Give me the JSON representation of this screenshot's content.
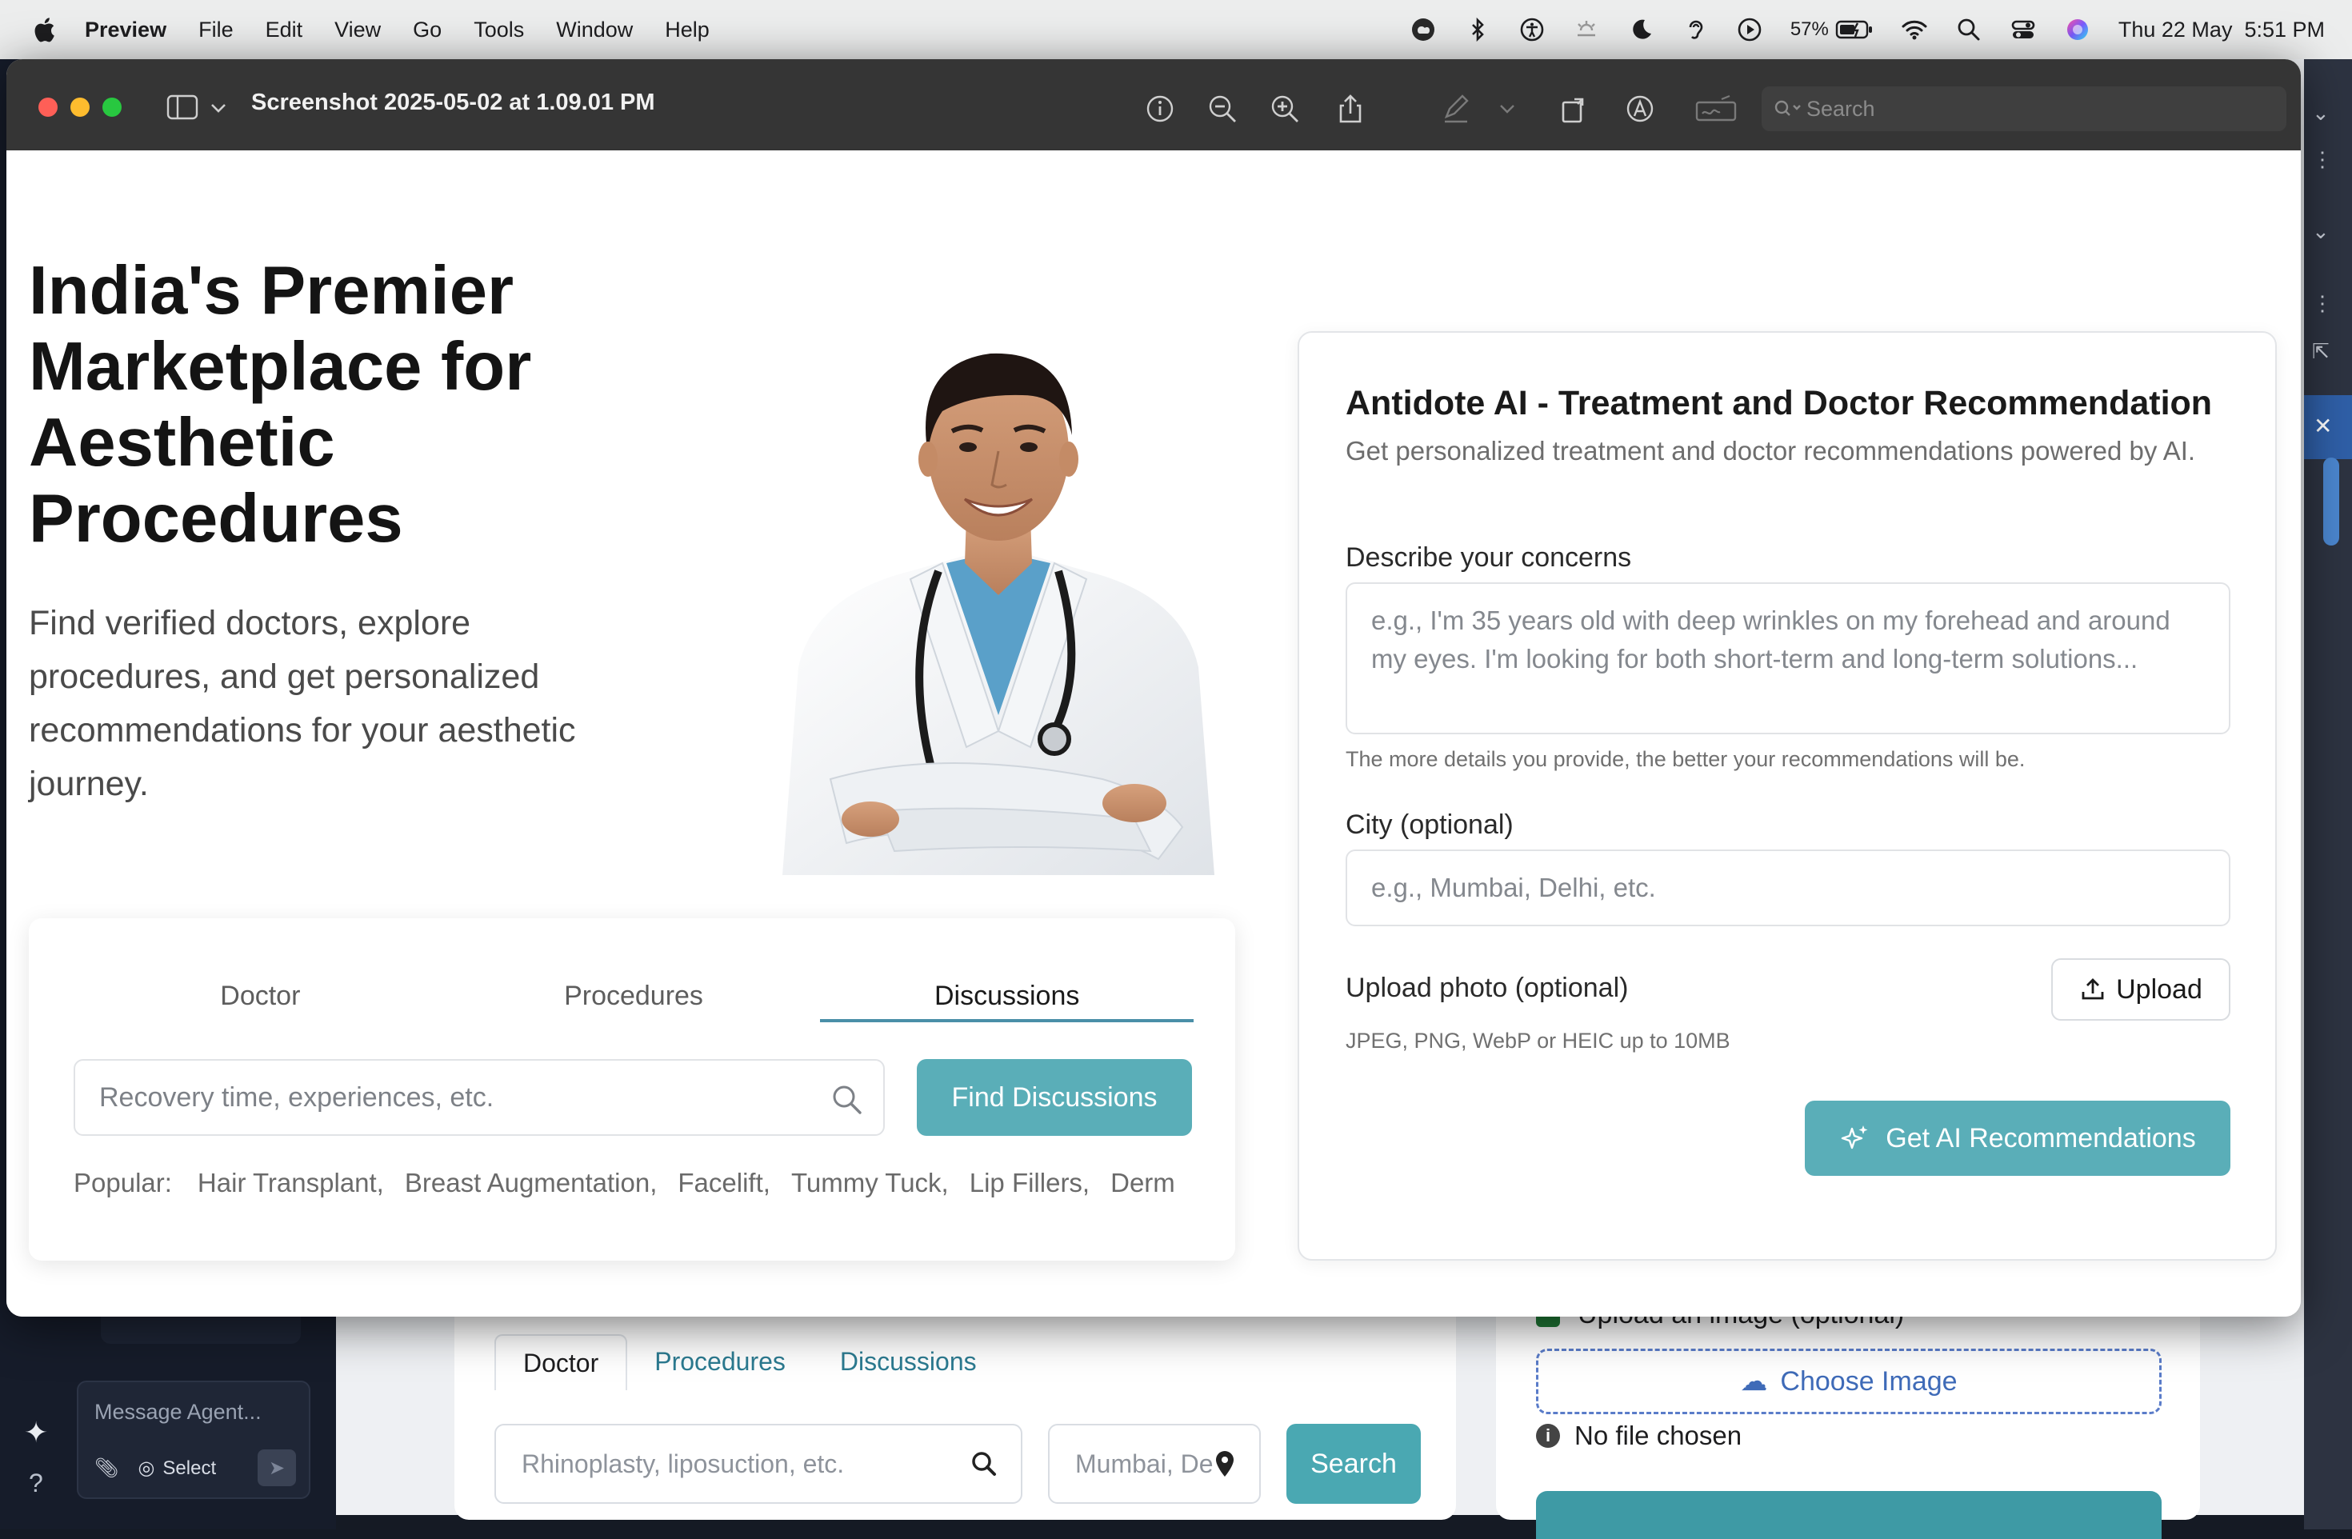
{
  "menubar": {
    "app_name": "Preview",
    "items": [
      "File",
      "Edit",
      "View",
      "Go",
      "Tools",
      "Window",
      "Help"
    ],
    "battery_percent": "57%",
    "datetime": "Thu 22 May  5:51 PM",
    "status_icons": [
      "creative-cloud-icon",
      "bluetooth-icon",
      "accessibility-icon",
      "brightness-icon",
      "focus-moon-icon",
      "hearing-icon",
      "play-icon",
      "battery-icon",
      "wifi-icon",
      "spotlight-search-icon",
      "control-center-icon",
      "siri-icon"
    ]
  },
  "preview": {
    "title": "Screenshot 2025-05-02 at 1.09.01 PM",
    "search_placeholder": "Search",
    "toolbar_icons": [
      "info-icon",
      "zoom-out-icon",
      "zoom-in-icon",
      "share-icon",
      "markup-pen-icon",
      "rotate-icon",
      "annotate-icon",
      "signature-icon"
    ]
  },
  "hero": {
    "title": "India's Premier Marketplace for Aesthetic Procedures",
    "subtitle": "Find verified doctors, explore procedures, and get personalized recommendations for your aesthetic journey."
  },
  "search_card": {
    "tabs": [
      "Doctor",
      "Procedures",
      "Discussions"
    ],
    "active_tab": "Discussions",
    "input_placeholder": "Recovery time, experiences, etc.",
    "button_label": "Find Discussions",
    "popular_label": "Popular:",
    "popular_items": [
      "Hair Transplant,",
      "Breast Augmentation,",
      "Facelift,",
      "Tummy Tuck,",
      "Lip Fillers,",
      "Derm"
    ]
  },
  "ai_card": {
    "title": "Antidote AI - Treatment and Doctor Recommendation",
    "description": "Get personalized treatment and doctor recommendations powered by AI.",
    "concerns_label": "Describe your concerns",
    "concerns_placeholder": "e.g., I'm 35 years old with deep wrinkles on my forehead and around my eyes. I'm looking for both short-term and long-term solutions...",
    "concerns_hint": "The more details you provide, the better your recommendations will be.",
    "city_label": "City (optional)",
    "city_placeholder": "e.g., Mumbai, Delhi, etc.",
    "upload_label": "Upload photo (optional)",
    "upload_button": "Upload",
    "upload_formats": "JPEG, PNG, WebP or HEIC up to 10MB",
    "submit_button": "Get AI Recommendations"
  },
  "background_app": {
    "message_placeholder": "Message Agent...",
    "select_label": "Select",
    "tabs": [
      "Doctor",
      "Procedures",
      "Discussions"
    ],
    "search_placeholder": "Rhinoplasty, liposuction, etc.",
    "city_placeholder": "Mumbai, De",
    "search_button": "Search",
    "upload_label": "Upload an image (optional)",
    "choose_image": "Choose Image",
    "no_file": "No file chosen"
  },
  "colors": {
    "accent_teal": "#5aaeb8",
    "tab_underline": "#4a8fa8",
    "titlebar": "#353535"
  }
}
